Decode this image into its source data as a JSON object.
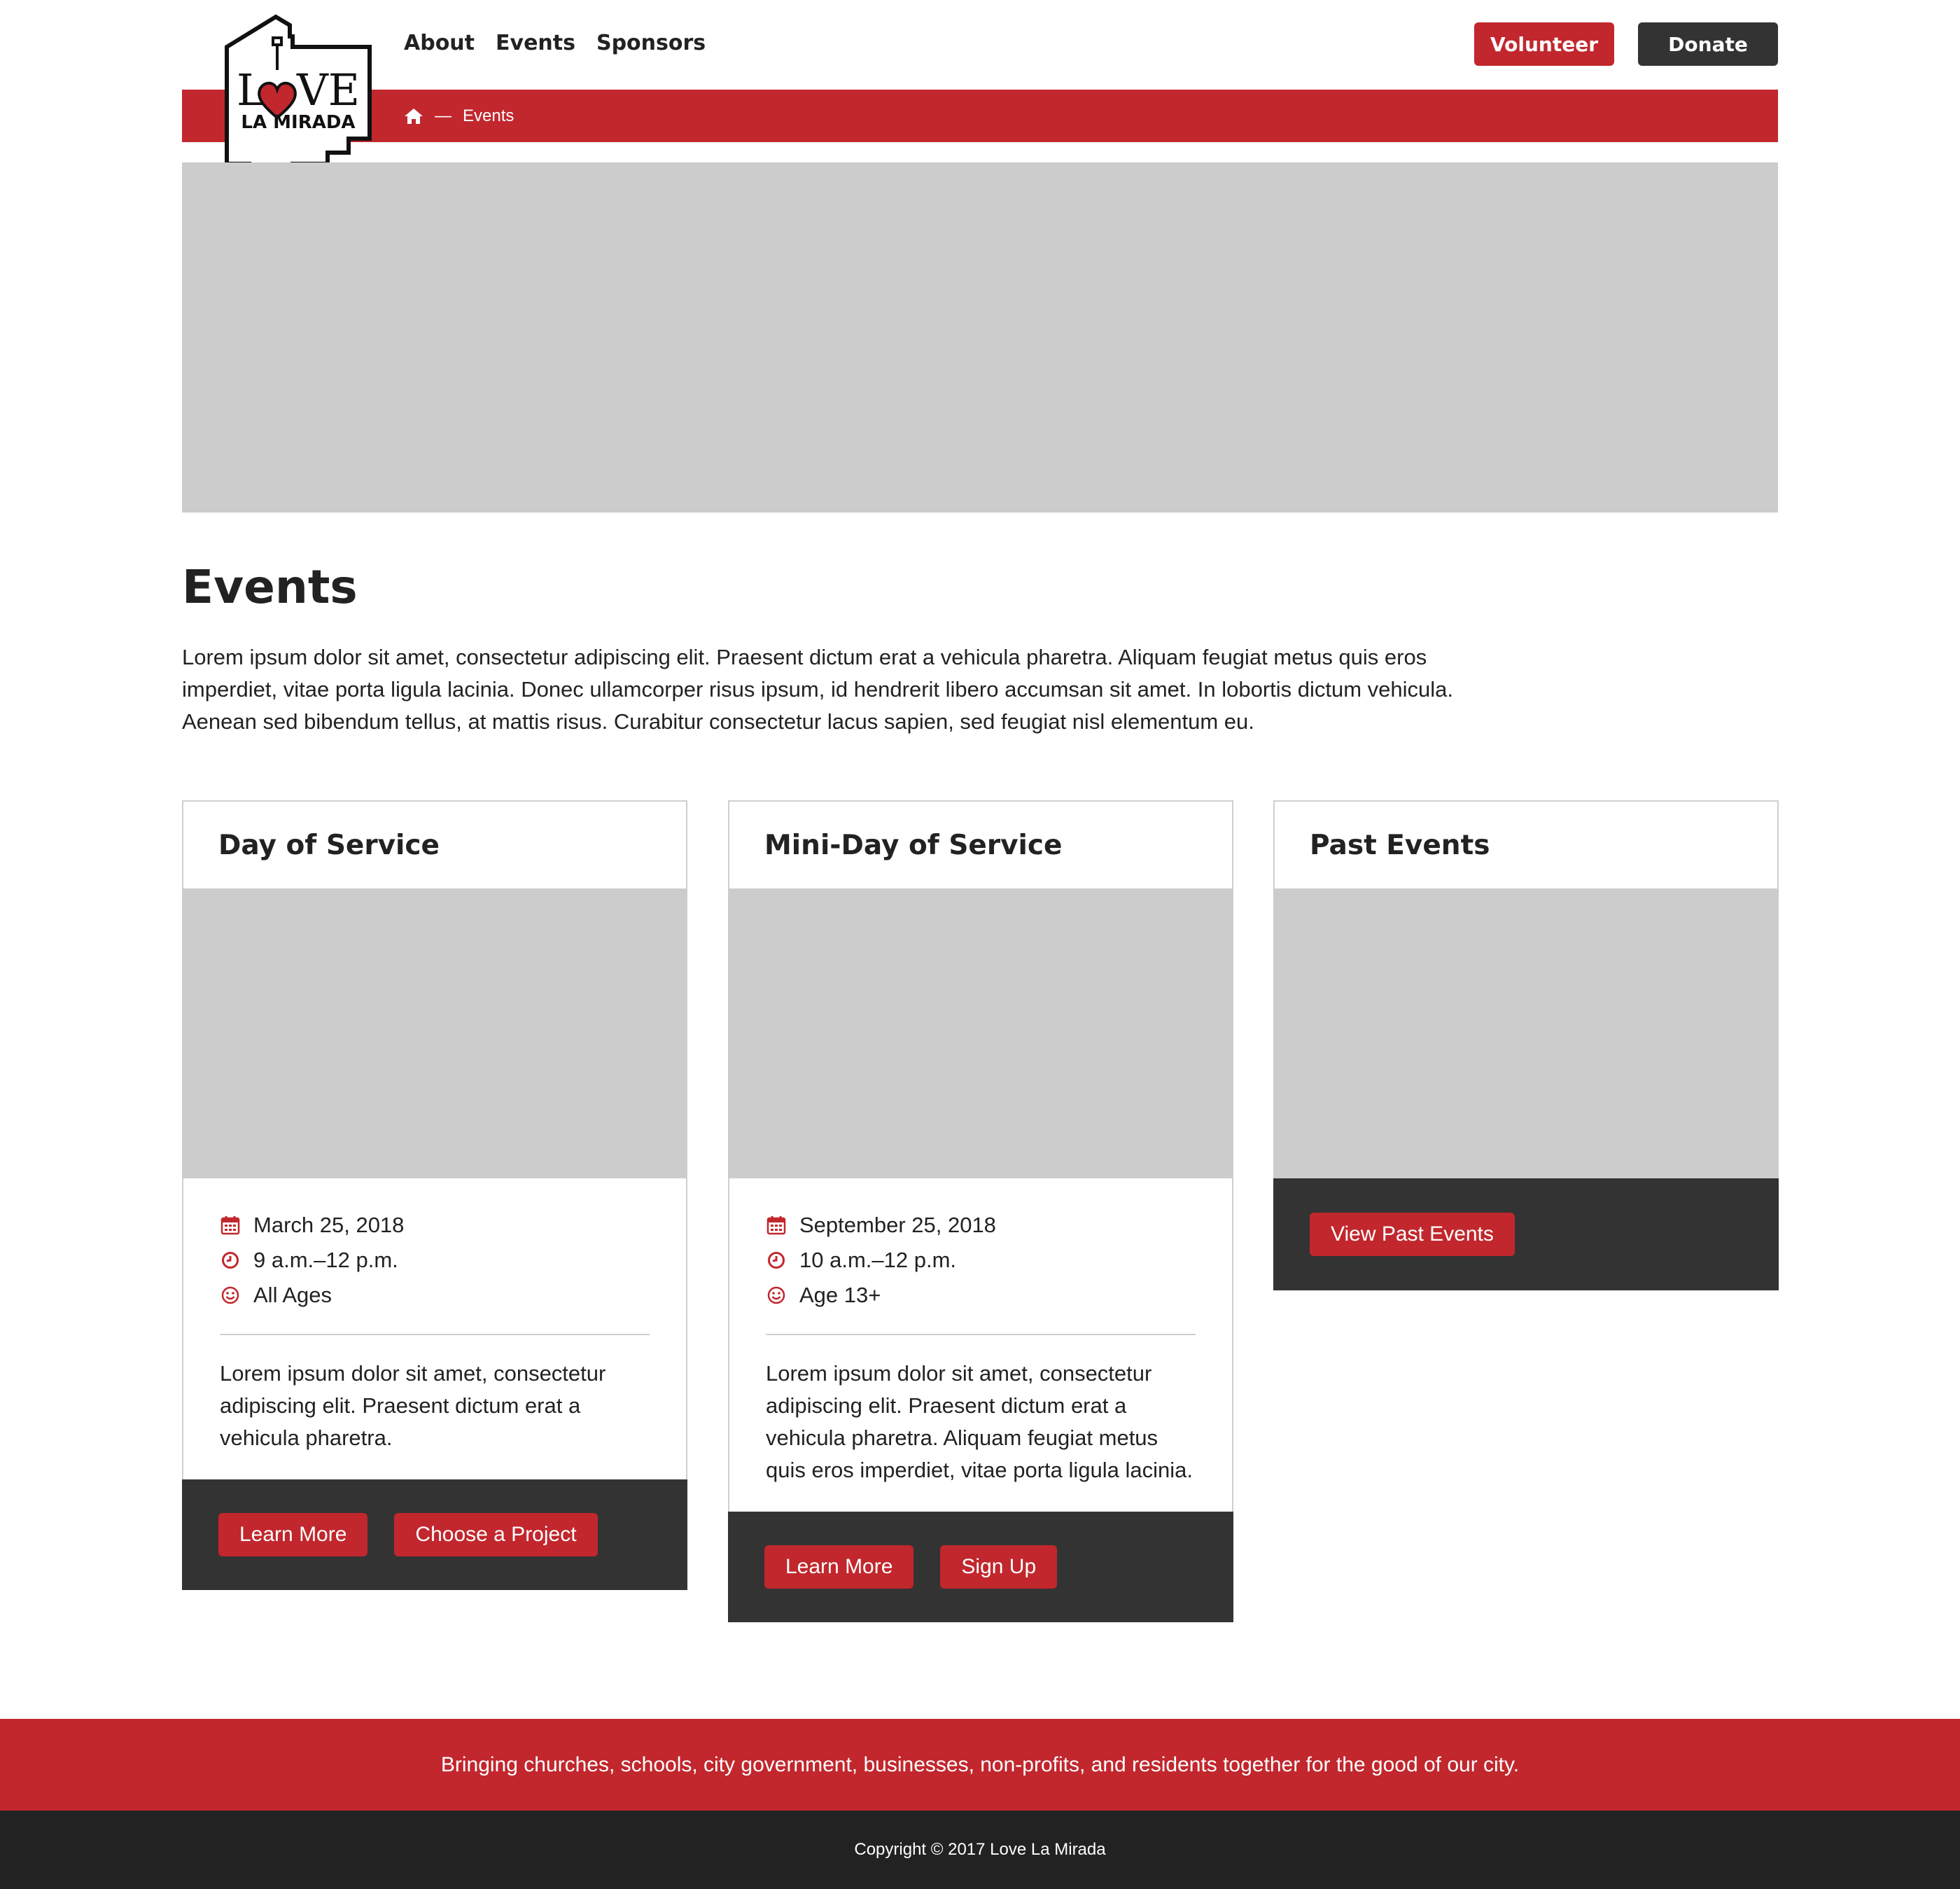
{
  "brand": {
    "logo_line1_left": "L",
    "logo_line1_right": "VE",
    "logo_line2": "LA MIRADA",
    "accent_color": "#c1272d",
    "dark_color": "#333333"
  },
  "nav": {
    "items": [
      {
        "label": "About"
      },
      {
        "label": "Events"
      },
      {
        "label": "Sponsors"
      }
    ],
    "volunteer_label": "Volunteer",
    "donate_label": "Donate"
  },
  "breadcrumb": {
    "home_icon": "home-icon",
    "separator": "—",
    "current": "Events"
  },
  "main": {
    "title": "Events",
    "intro": "Lorem ipsum dolor sit amet, consectetur adipiscing elit. Praesent dictum erat a vehicula pharetra. Aliquam feugiat metus quis eros imperdiet, vitae porta ligula lacinia. Donec ullamcorper risus ipsum, id hendrerit libero accumsan sit amet. In lobortis dictum vehicula. Aenean sed bibendum tellus, at mattis risus. Curabitur consectetur lacus sapien, sed feugiat nisl elementum eu."
  },
  "cards": [
    {
      "title": "Day of Service",
      "date": "March 25, 2018",
      "time": "9 a.m.–12 p.m.",
      "ages": "All Ages",
      "description": "Lorem ipsum dolor sit amet, consectetur adipiscing elit. Praesent dictum erat a vehicula pharetra.",
      "buttons": [
        "Learn More",
        "Choose a Project"
      ]
    },
    {
      "title": "Mini-Day of Service",
      "date": "September 25, 2018",
      "time": "10 a.m.–12 p.m.",
      "ages": "Age 13+",
      "description": "Lorem ipsum dolor sit amet, consectetur adipiscing elit. Praesent dictum erat a vehicula pharetra. Aliquam feugiat metus quis eros imperdiet, vitae porta ligula lacinia.",
      "buttons": [
        "Learn More",
        "Sign Up"
      ]
    },
    {
      "title": "Past Events",
      "buttons": [
        "View Past Events"
      ]
    }
  ],
  "icons": {
    "date": "calendar-icon",
    "time": "clock-icon",
    "ages": "smiley-icon"
  },
  "footer": {
    "tagline": "Bringing churches, schools, city government, businesses, non-profits, and residents together for the good of our city.",
    "copyright": "Copyright © 2017 Love La Mirada"
  }
}
